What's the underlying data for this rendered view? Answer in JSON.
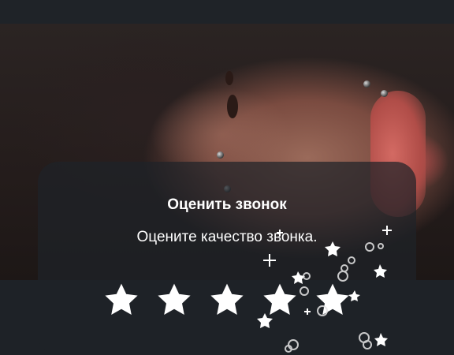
{
  "rating_dialog": {
    "title": "Оценить звонок",
    "subtitle": "Оцените качество звонка.",
    "stars": [
      {
        "icon": "star-icon"
      },
      {
        "icon": "star-icon"
      },
      {
        "icon": "star-icon"
      },
      {
        "icon": "star-icon"
      },
      {
        "icon": "star-icon"
      }
    ]
  },
  "colors": {
    "background": "#1e2227",
    "dialog_overlay": "#1e2228",
    "text": "#ffffff",
    "star": "#ffffff"
  }
}
